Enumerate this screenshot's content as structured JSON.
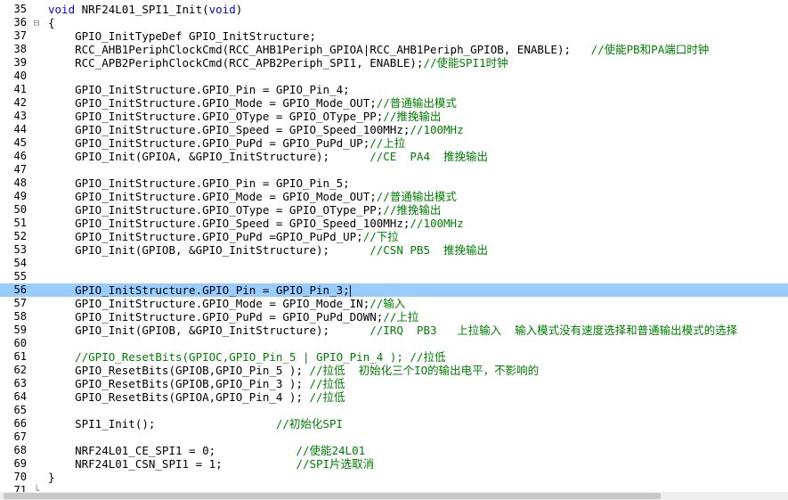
{
  "editor": {
    "current_line": "56",
    "lines": [
      {
        "n": "35",
        "fold": "",
        "code": "void NRF24L01_SPI1_Init(void)",
        "comment": "",
        "kw": "void"
      },
      {
        "n": "36",
        "fold": "⊟",
        "code": "{",
        "comment": ""
      },
      {
        "n": "37",
        "fold": "",
        "code": "    GPIO_InitTypeDef GPIO_InitStructure;",
        "comment": ""
      },
      {
        "n": "38",
        "fold": "",
        "code": "    RCC_AHB1PeriphClockCmd(RCC_AHB1Periph_GPIOA|RCC_AHB1Periph_GPIOB, ENABLE);   ",
        "comment": "//使能PB和PA端口时钟"
      },
      {
        "n": "39",
        "fold": "",
        "code": "    RCC_APB2PeriphClockCmd(RCC_APB2Periph_SPI1, ENABLE);",
        "comment": "//使能SPI1时钟"
      },
      {
        "n": "40",
        "fold": "",
        "code": "",
        "comment": ""
      },
      {
        "n": "41",
        "fold": "",
        "code": "    GPIO_InitStructure.GPIO_Pin = GPIO_Pin_4;",
        "comment": ""
      },
      {
        "n": "42",
        "fold": "",
        "code": "    GPIO_InitStructure.GPIO_Mode = GPIO_Mode_OUT;",
        "comment": "//普通输出模式"
      },
      {
        "n": "43",
        "fold": "",
        "code": "    GPIO_InitStructure.GPIO_OType = GPIO_OType_PP;",
        "comment": "//推挽输出"
      },
      {
        "n": "44",
        "fold": "",
        "code": "    GPIO_InitStructure.GPIO_Speed = GPIO_Speed_100MHz;",
        "comment": "//100MHz"
      },
      {
        "n": "45",
        "fold": "",
        "code": "    GPIO_InitStructure.GPIO_PuPd = GPIO_PuPd_UP;",
        "comment": "//上拉"
      },
      {
        "n": "46",
        "fold": "",
        "code": "    GPIO_Init(GPIOA, &GPIO_InitStructure);      ",
        "comment": "//CE  PA4  推挽输出"
      },
      {
        "n": "47",
        "fold": "",
        "code": "",
        "comment": ""
      },
      {
        "n": "48",
        "fold": "",
        "code": "    GPIO_InitStructure.GPIO_Pin = GPIO_Pin_5;",
        "comment": ""
      },
      {
        "n": "49",
        "fold": "",
        "code": "    GPIO_InitStructure.GPIO_Mode = GPIO_Mode_OUT;",
        "comment": "//普通输出模式"
      },
      {
        "n": "50",
        "fold": "",
        "code": "    GPIO_InitStructure.GPIO_OType = GPIO_OType_PP;",
        "comment": "//推挽输出"
      },
      {
        "n": "51",
        "fold": "",
        "code": "    GPIO_InitStructure.GPIO_Speed = GPIO_Speed_100MHz;",
        "comment": "//100MHz"
      },
      {
        "n": "52",
        "fold": "",
        "code": "    GPIO_InitStructure.GPIO_PuPd =GPIO_PuPd_UP;",
        "comment": "//下拉"
      },
      {
        "n": "53",
        "fold": "",
        "code": "    GPIO_Init(GPIOB, &GPIO_InitStructure);      ",
        "comment": "//CSN PB5  推挽输出"
      },
      {
        "n": "54",
        "fold": "",
        "code": "",
        "comment": ""
      },
      {
        "n": "55",
        "fold": "",
        "code": "",
        "comment": ""
      },
      {
        "n": "56",
        "fold": "",
        "code": "    GPIO_InitStructure.GPIO_Pin = GPIO_Pin_3;",
        "comment": ""
      },
      {
        "n": "57",
        "fold": "",
        "code": "    GPIO_InitStructure.GPIO_Mode = GPIO_Mode_IN;",
        "comment": "//输入"
      },
      {
        "n": "58",
        "fold": "",
        "code": "    GPIO_InitStructure.GPIO_PuPd = GPIO_PuPd_DOWN;",
        "comment": "//上拉"
      },
      {
        "n": "59",
        "fold": "",
        "code": "    GPIO_Init(GPIOB, &GPIO_InitStructure);      ",
        "comment": "//IRQ  PB3   上拉输入  输入模式没有速度选择和普通输出模式的选择"
      },
      {
        "n": "60",
        "fold": "",
        "code": "",
        "comment": ""
      },
      {
        "n": "61",
        "fold": "",
        "code": "    ",
        "comment": "//GPIO_ResetBits(GPIOC,GPIO_Pin_5 | GPIO_Pin_4 ); //拉低"
      },
      {
        "n": "62",
        "fold": "",
        "code": "    GPIO_ResetBits(GPIOB,GPIO_Pin_5 ); ",
        "comment": "//拉低  初始化三个IO的输出电平，不影响的"
      },
      {
        "n": "63",
        "fold": "",
        "code": "    GPIO_ResetBits(GPIOB,GPIO_Pin_3 ); ",
        "comment": "//拉低"
      },
      {
        "n": "64",
        "fold": "",
        "code": "    GPIO_ResetBits(GPIOA,GPIO_Pin_4 ); ",
        "comment": "//拉低"
      },
      {
        "n": "65",
        "fold": "",
        "code": "",
        "comment": ""
      },
      {
        "n": "66",
        "fold": "",
        "code": "    SPI1_Init();                  ",
        "comment": "//初始化SPI"
      },
      {
        "n": "67",
        "fold": "",
        "code": "",
        "comment": ""
      },
      {
        "n": "68",
        "fold": "",
        "code": "    NRF24L01_CE_SPI1 = 0;            ",
        "comment": "//使能24L01"
      },
      {
        "n": "69",
        "fold": "",
        "code": "    NRF24L01_CSN_SPI1 = 1;           ",
        "comment": "//SPI片选取消"
      },
      {
        "n": "70",
        "fold": "",
        "code": "}",
        "comment": ""
      },
      {
        "n": "71",
        "fold": "└",
        "code": "",
        "comment": ""
      }
    ]
  },
  "colors": {
    "comment": "#008000",
    "keyword": "#0000ff",
    "current_line_bg": "#99ccff"
  }
}
